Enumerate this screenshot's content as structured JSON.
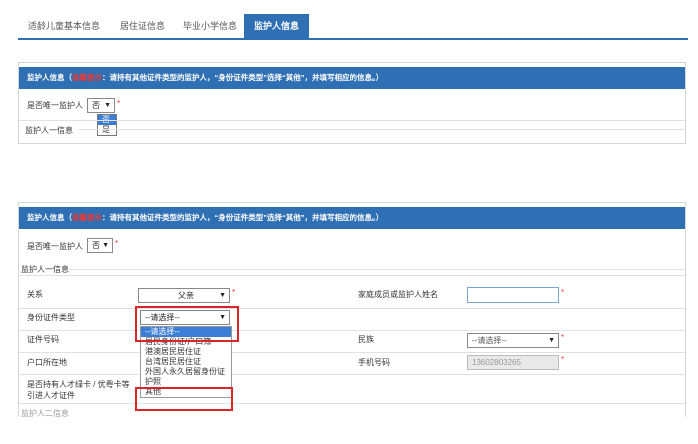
{
  "tabs": [
    {
      "label": "适龄儿童基本信息"
    },
    {
      "label": "居住证信息"
    },
    {
      "label": "毕业小学信息"
    },
    {
      "label": "监护人信息"
    }
  ],
  "panel1": {
    "head_prefix": "监护人信息（",
    "head_red": "温馨提示",
    "head_suffix": "：请持有其他证件类型的监护人，“身份证件类型”选择“其他”，并填写相应的信息。）",
    "only_guardian_label": "是否唯一监护人",
    "only_guardian_value": "否",
    "options": [
      "否",
      "是"
    ],
    "guardian1_label": "监护人一信息"
  },
  "panel2": {
    "head_prefix": "监护人信息（",
    "head_red": "温馨提示",
    "head_suffix": "：请持有其他证件类型的监护人，“身份证件类型”选择“其他”，并填写相应的信息。）",
    "only_guardian_label": "是否唯一监护人",
    "only_guardian_value": "否",
    "guardian1_label": "监护人一信息",
    "relation_label": "关系",
    "relation_value": "父亲",
    "family_name_label": "家庭成员或监护人姓名",
    "id_type_label": "身份证件类型",
    "id_type_value": "--请选择--",
    "id_type_options": [
      "--请选择--",
      "居民身份证/户口簿",
      "港澳居民居住证",
      "台湾居民居住证",
      "外国人永久居留身份证",
      "护照",
      "其他"
    ],
    "id_no_label": "证件号码",
    "ethnic_label": "民族",
    "ethnic_value": "--请选择--",
    "hukou_label": "户口所在地",
    "phone_label": "手机号码",
    "phone_value": "13602803265",
    "talent_label_1": "是否持有人才绿卡 / 优粤卡等",
    "talent_label_2": "引进人才证件",
    "guardian2_label": "监护人二信息"
  },
  "colors": {
    "accent": "#2f6fb3",
    "required": "#e23b3b",
    "highlight": "#3c7ed6",
    "callout": "#d9262b"
  }
}
